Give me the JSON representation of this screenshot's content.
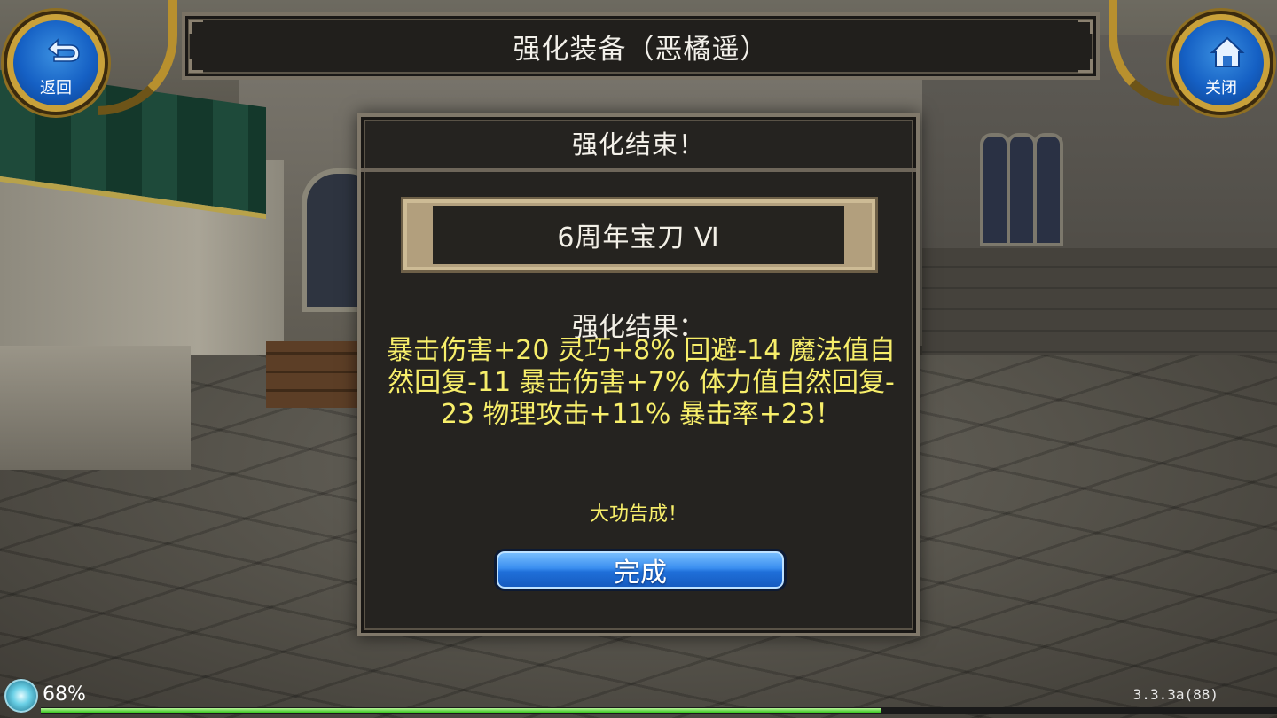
{
  "header": {
    "title": "强化装备（恶橘遥）",
    "back_label": "返回",
    "close_label": "关闭"
  },
  "dialog": {
    "title": "强化结束！",
    "item_name": "6周年宝刀 Ⅵ",
    "result_label": "强化结果：",
    "result_text": "暴击伤害+20 灵巧+8% 回避-14 魔法值自然回复-11 暴击伤害+7% 体力值自然回复-23 物理攻击+11% 暴击率+23！",
    "success_text": "大功告成！",
    "done_label": "完成"
  },
  "status": {
    "percent_label": "68%",
    "hp_fraction": 0.68,
    "version": "3.3.3a(88)"
  },
  "colors": {
    "result_yellow": "#f7ee6a",
    "button_blue": "#1f6fd9",
    "frame_gold": "#c9a13a"
  },
  "icons": {
    "back": "back-arrow-icon",
    "close": "home-icon"
  }
}
